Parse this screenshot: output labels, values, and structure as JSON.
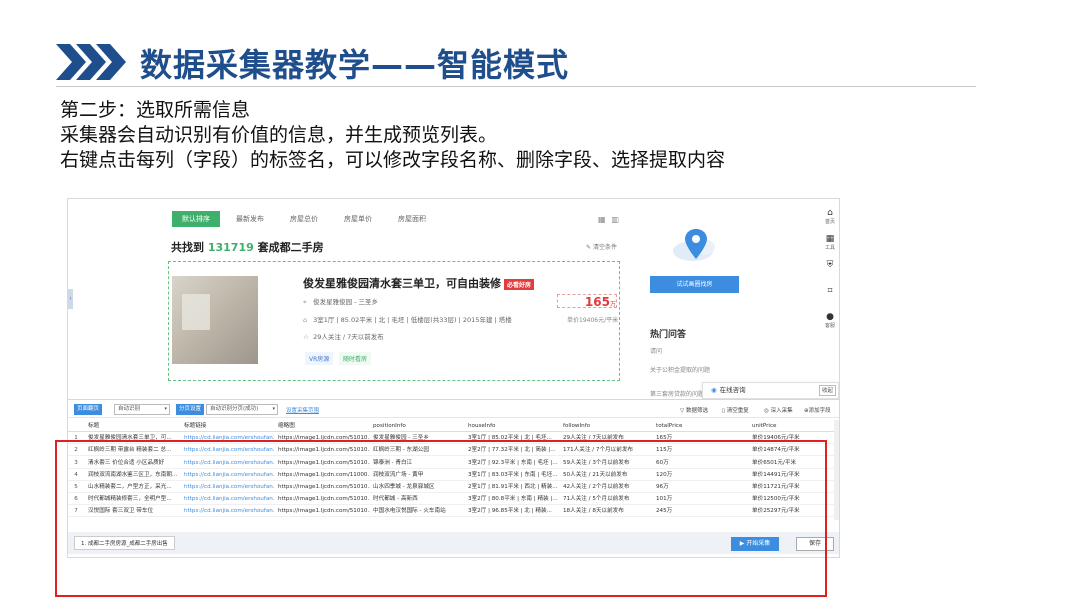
{
  "slide": {
    "title": "数据采集器教学——智能模式",
    "lines": [
      "第二步：选取所需信息",
      "采集器会自动识别有价值的信息，并生成预览列表。",
      "右键点击每列（字段）的标签名，可以修改字段名称、删除字段、选择提取内容"
    ]
  },
  "webpage": {
    "tabs": [
      "默认排序",
      "最新发布",
      "房屋总价",
      "房屋单价",
      "房屋面积"
    ],
    "found_prefix": "共找到",
    "found_count": "131719",
    "found_suffix": "套成都二手房",
    "clear_filter": "清空条件",
    "listing": {
      "title": "俊发星雅俊园清水套三单卫，可自由装修",
      "hot_tag": "必看好房",
      "location": "俊发星雅俊园 - 三圣乡",
      "house_info": "3室1厅 | 85.02平米 | 北 | 毛坯 | 低楼层(共33层) | 2015年建 | 塔楼",
      "follow_info": "29人关注 / 7天以前发布",
      "price": "165",
      "price_unit": "万",
      "unit_price": "单价19406元/平米",
      "tags": [
        "VR房源",
        "随时看房"
      ]
    },
    "map_button": "试试画圈找房",
    "hot_qa": {
      "title": "热门问答",
      "items": [
        "请问",
        "关于公积金提取的问题",
        "第三套房贷款的问题"
      ]
    },
    "sidebar": [
      "首页",
      "工具",
      "",
      "",
      "客服"
    ],
    "chat": {
      "label": "在线咨询",
      "collapse": "收起"
    }
  },
  "collector": {
    "toolbar": {
      "list_label": "页面翻页",
      "list_select": "自动识别",
      "page_label": "分页设置",
      "page_select": "自动识别分页(成功)",
      "link": "设置采集范围",
      "right": [
        "数据筛选",
        "清空重复",
        "深入采集",
        "添加字段"
      ]
    },
    "columns": [
      "标题",
      "标题链接",
      "缩略图",
      "positionInfo",
      "houseInfo",
      "followInfo",
      "totalPrice",
      "unitPrice"
    ],
    "rows": [
      {
        "n": "1",
        "c": [
          "俊发星雅俊园清水套三单卫，可...",
          "https://cd.lianjia.com/ershoufan...",
          "https://image1.ljcdn.com/51010...",
          "俊发星雅俊园 - 三圣乡",
          "3室1厅 | 85.02平米 | 北 | 毛坯...",
          "29人关注 / 7天以前发布",
          "165万",
          "单价19406元/平米"
        ]
      },
      {
        "n": "2",
        "c": [
          "红枫岭三期 带露台 精装套二 总...",
          "https://cd.lianjia.com/ershoufan...",
          "https://image1.ljcdn.com/51010...",
          "红枫岭三期 - 东湖公园",
          "2室2厅 | 77.32平米 | 北 | 简装 |...",
          "171人关注 / 7个月以前发布",
          "115万",
          "单价14874元/平米"
        ]
      },
      {
        "n": "3",
        "c": [
          "清水套三 价位合适 小区品质好",
          "https://cd.lianjia.com/ershoufan...",
          "https://image1.ljcdn.com/51010...",
          "锦泰洲 - 青白江",
          "3室2厅 | 92.3平米 | 东南 | 毛坯 |...",
          "59人关注 / 3个月以前发布",
          "60万",
          "单价6501元/平米"
        ]
      },
      {
        "n": "4",
        "c": [
          "润枝双流南湖水鉴三区卫，东南朝...",
          "https://cd.lianjia.com/ershoufan...",
          "https://image1.ljcdn.com/11000...",
          "润枝双流广场 - 黄甲",
          "3室1厅 | 83.03平米 | 东南 | 毛坯...",
          "50人关注 / 21天以前发布",
          "120万",
          "单价14491元/平米"
        ]
      },
      {
        "n": "5",
        "c": [
          "山水精装套二，户型方正，采光...",
          "https://cd.lianjia.com/ershoufan...",
          "https://image1.ljcdn.com/51010...",
          "山水四季城 - 龙泉驿城区",
          "2室1厅 | 81.91平米 | 西北 | 精装...",
          "42人关注 / 2个月以前发布",
          "96万",
          "单价11721元/平米"
        ]
      },
      {
        "n": "6",
        "c": [
          "时代都城精装修套三，全明户型...",
          "https://cd.lianjia.com/ershoufan...",
          "https://image1.ljcdn.com/51010...",
          "时代都城 - 高新西",
          "3室2厅 | 80.8平米 | 东南 | 精装 |...",
          "71人关注 / 5个月以前发布",
          "101万",
          "单价12500元/平米"
        ]
      },
      {
        "n": "7",
        "c": [
          "汉悦国际 套三双卫 带车位",
          "https://cd.lianjia.com/ershoufan...",
          "https://image1.ljcdn.com/51010...",
          "中国水电汉悦国际 - 火车南站",
          "3室2厅 | 96.85平米 | 北 | 精装...",
          "18人关注 / 8天以前发布",
          "245万",
          "单价25297元/平米"
        ]
      }
    ],
    "footer": {
      "task_tab": "1. 成都二手房房源_成都二手房出售",
      "start_button": "开始采集",
      "save_button": "保存"
    }
  },
  "colors": {
    "title_blue": "#1f4e8c",
    "accent_green": "#3eb06b",
    "link_blue": "#3c8de0",
    "price_red": "#e4393c",
    "highlight_red": "#e02020"
  }
}
